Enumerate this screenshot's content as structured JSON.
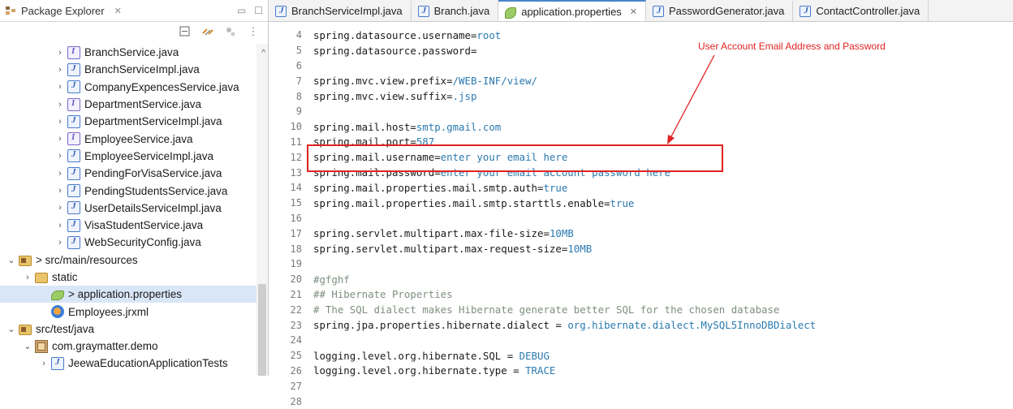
{
  "package_explorer": {
    "title": "Package Explorer",
    "close_glyph": "✕",
    "minimize_glyph": "▭",
    "maximize_glyph": "☐",
    "menu_glyph": "⋮"
  },
  "tree": [
    {
      "label": "BranchService.java",
      "icon": "interface-icon",
      "chev": "›",
      "indent": 3
    },
    {
      "label": "BranchServiceImpl.java",
      "icon": "class-icon",
      "chev": "›",
      "indent": 3
    },
    {
      "label": "CompanyExpencesService.java",
      "icon": "class-icon",
      "chev": "›",
      "indent": 3
    },
    {
      "label": "DepartmentService.java",
      "icon": "interface-icon",
      "chev": "›",
      "indent": 3
    },
    {
      "label": "DepartmentServiceImpl.java",
      "icon": "class-icon",
      "chev": "›",
      "indent": 3
    },
    {
      "label": "EmployeeService.java",
      "icon": "interface-icon",
      "chev": "›",
      "indent": 3
    },
    {
      "label": "EmployeeServiceImpl.java",
      "icon": "class-icon",
      "chev": "›",
      "indent": 3
    },
    {
      "label": "PendingForVisaService.java",
      "icon": "class-icon",
      "chev": "›",
      "indent": 3
    },
    {
      "label": "PendingStudentsService.java",
      "icon": "class-icon",
      "chev": "›",
      "indent": 3
    },
    {
      "label": "UserDetailsServiceImpl.java",
      "icon": "class-icon",
      "chev": "›",
      "indent": 3
    },
    {
      "label": "VisaStudentService.java",
      "icon": "class-icon",
      "chev": "›",
      "indent": 3
    },
    {
      "label": "WebSecurityConfig.java",
      "icon": "class-icon",
      "chev": "›",
      "indent": 3
    },
    {
      "label": "> src/main/resources",
      "icon": "source-folder-icon",
      "chev": "⌄",
      "indent": 0
    },
    {
      "label": "static",
      "icon": "folder-icon",
      "chev": "›",
      "indent": 1
    },
    {
      "label": "> application.properties",
      "icon": "properties-file-icon",
      "chev": "",
      "indent": 2,
      "selected": true
    },
    {
      "label": "Employees.jrxml",
      "icon": "jrxml-file-icon",
      "chev": "",
      "indent": 2
    },
    {
      "label": "src/test/java",
      "icon": "source-folder-icon",
      "chev": "⌄",
      "indent": 0
    },
    {
      "label": "com.graymatter.demo",
      "icon": "package-icon",
      "chev": "⌄",
      "indent": 1
    },
    {
      "label": "JeewaEducationApplicationTests",
      "icon": "class-icon",
      "chev": "›",
      "indent": 2
    }
  ],
  "tabs": [
    {
      "label": "BranchServiceImpl.java",
      "icon": "class-icon",
      "active": false
    },
    {
      "label": "Branch.java",
      "icon": "class-icon",
      "active": false
    },
    {
      "label": "application.properties",
      "icon": "properties-file-icon",
      "active": true,
      "close": "✕"
    },
    {
      "label": "PasswordGenerator.java",
      "icon": "class-icon",
      "active": false
    },
    {
      "label": "ContactController.java",
      "icon": "class-icon",
      "active": false
    }
  ],
  "code_lines": [
    {
      "n": "4",
      "k": "spring.datasource.username=",
      "v": "root"
    },
    {
      "n": "5",
      "k": "spring.datasource.password=",
      "v": ""
    },
    {
      "n": "6",
      "k": "",
      "v": ""
    },
    {
      "n": "7",
      "k": "spring.mvc.view.prefix=",
      "v": "/WEB-INF/view/"
    },
    {
      "n": "8",
      "k": "spring.mvc.view.suffix=",
      "v": ".jsp"
    },
    {
      "n": "9",
      "k": "",
      "v": ""
    },
    {
      "n": "10",
      "k": "spring.mail.host=",
      "v": "smtp.gmail.com"
    },
    {
      "n": "11",
      "k": "spring.mail.port=",
      "v": "587"
    },
    {
      "n": "12",
      "k": "spring.mail.username=",
      "v": "enter your email here"
    },
    {
      "n": "13",
      "k": "spring.mail.password=",
      "v": "enter your email account password here"
    },
    {
      "n": "14",
      "k": "spring.mail.properties.mail.smtp.auth=",
      "v": "true"
    },
    {
      "n": "15",
      "k": "spring.mail.properties.mail.smtp.starttls.enable=",
      "v": "true"
    },
    {
      "n": "16",
      "k": "",
      "v": ""
    },
    {
      "n": "17",
      "k": "spring.servlet.multipart.max-file-size=",
      "v": "10MB"
    },
    {
      "n": "18",
      "k": "spring.servlet.multipart.max-request-size=",
      "v": "10MB"
    },
    {
      "n": "19",
      "k": "",
      "v": ""
    },
    {
      "n": "20",
      "c": "#gfghf"
    },
    {
      "n": "21",
      "c": "## Hibernate Properties"
    },
    {
      "n": "22",
      "c": "# The SQL dialect makes Hibernate generate better SQL for the chosen database"
    },
    {
      "n": "23",
      "k": "spring.jpa.properties.hibernate.dialect = ",
      "v": "org.hibernate.dialect.MySQL5InnoDBDialect"
    },
    {
      "n": "24",
      "k": "",
      "v": ""
    },
    {
      "n": "25",
      "k": "logging.level.org.hibernate.SQL = ",
      "v": "DEBUG"
    },
    {
      "n": "26",
      "k": "logging.level.org.hibernate.type = ",
      "v": "TRACE"
    },
    {
      "n": "27",
      "k": "",
      "v": ""
    },
    {
      "n": "28",
      "k": "",
      "v": ""
    }
  ],
  "annotation": "User Account Email Address and Password",
  "colors": {
    "annotation": "#e02222",
    "value": "#2a7ab0",
    "comment": "#7f8f7f"
  }
}
